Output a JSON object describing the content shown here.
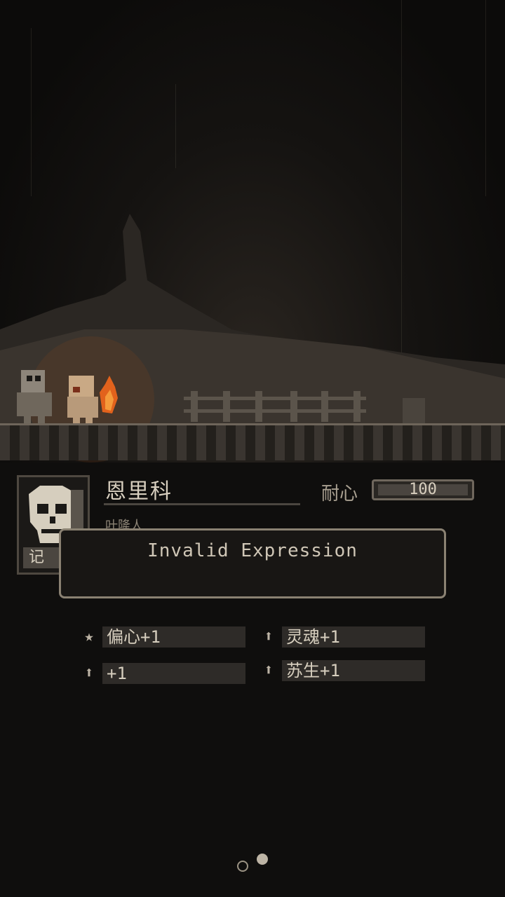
{
  "character": {
    "name": "恩里科",
    "subtitle": "叶隆人",
    "portrait_tag": "记",
    "patience_label": "耐心",
    "patience_value": "100",
    "patience_fraction": 1.0
  },
  "dialog": {
    "message": "Invalid Expression"
  },
  "traits": [
    {
      "icon": "star-icon",
      "label": "偏心+1"
    },
    {
      "icon": "arrow-up-icon",
      "label": "灵魂+1"
    },
    {
      "icon": "arrow-up-icon",
      "label": "+1"
    },
    {
      "icon": "arrow-up-icon",
      "label": "苏生+1"
    }
  ],
  "pager": {
    "count": 2,
    "active_index": 1
  }
}
